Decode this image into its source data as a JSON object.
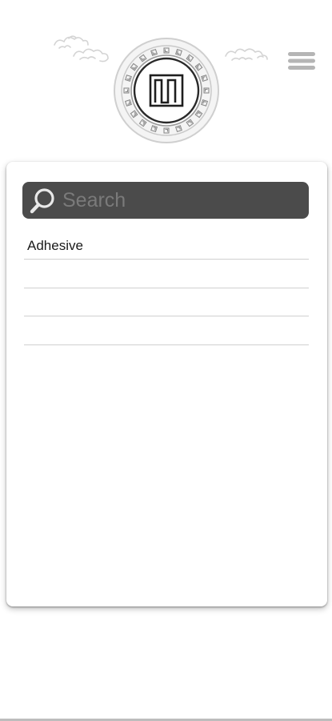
{
  "header": {
    "logo_icon": "maze-emblem-icon",
    "menu_icon": "hamburger-menu-icon"
  },
  "search": {
    "placeholder": "Search",
    "icon": "search-icon",
    "bar_color": "#4b4b4b"
  },
  "list": {
    "items": [
      {
        "label": "Adhesive"
      },
      {
        "label": ""
      },
      {
        "label": ""
      },
      {
        "label": ""
      }
    ]
  }
}
